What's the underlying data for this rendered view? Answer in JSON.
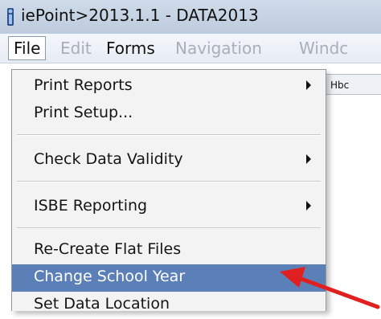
{
  "window": {
    "title": "iePoint>2013.1.1 - DATA2013"
  },
  "menubar": {
    "items": [
      {
        "label": "File"
      },
      {
        "label": "Edit"
      },
      {
        "label": "Forms"
      },
      {
        "label": "Navigation"
      },
      {
        "label": "Windc"
      }
    ]
  },
  "background_tab": {
    "label": "Hbc"
  },
  "file_menu": {
    "items": [
      {
        "label": "Print Reports"
      },
      {
        "label": "Print Setup..."
      },
      {
        "label": "Check Data Validity"
      },
      {
        "label": "ISBE Reporting"
      },
      {
        "label": "Re-Create Flat Files"
      },
      {
        "label": "Change School Year"
      },
      {
        "label": "Set Data Location"
      }
    ],
    "highlighted_item": "Change School Year"
  },
  "colors": {
    "highlight": "#5b80b8",
    "annotation_arrow": "#e02020"
  },
  "icons": {
    "app": "iepoint-app-icon",
    "submenu": "submenu-arrow-icon",
    "annotation": "red-arrow-annotation"
  }
}
